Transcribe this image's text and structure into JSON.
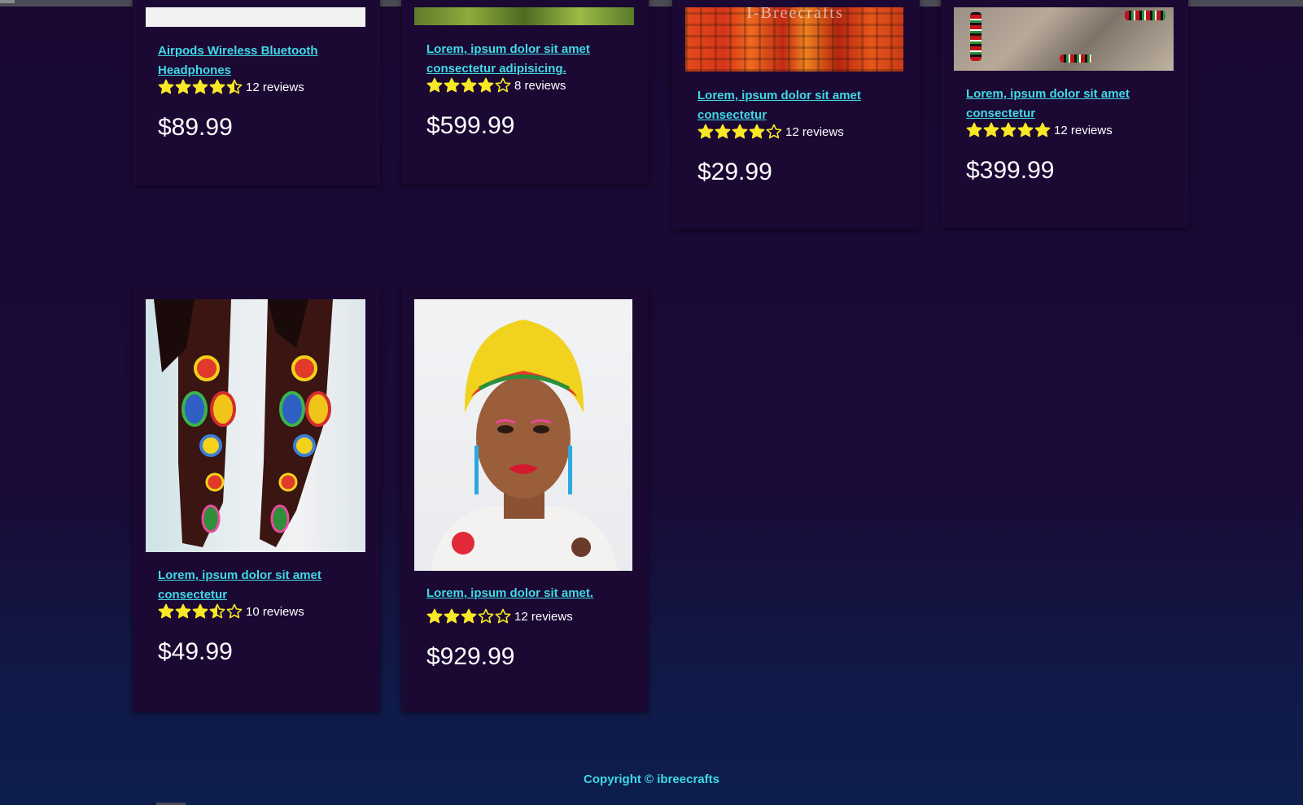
{
  "products": [
    {
      "title": "Airpods Wireless Bluetooth Headphones",
      "rating": 4.5,
      "reviews": "12 reviews",
      "price": "$89.99"
    },
    {
      "title": "Lorem, ipsum dolor sit amet consectetur adipisicing.",
      "rating": 4,
      "reviews": "8 reviews",
      "price": "$599.99"
    },
    {
      "title": "Lorem, ipsum dolor sit amet consectetur",
      "rating": 4,
      "reviews": "12 reviews",
      "price": "$29.99"
    },
    {
      "title": "Lorem, ipsum dolor sit amet consectetur",
      "rating": 5,
      "reviews": "12 reviews",
      "price": "$399.99"
    },
    {
      "title": "Lorem, ipsum dolor sit amet consectetur",
      "rating": 3.5,
      "reviews": "10 reviews",
      "price": "$49.99"
    },
    {
      "title": "Lorem, ipsum dolor sit amet.",
      "rating": 3,
      "reviews": "12 reviews",
      "price": "$929.99"
    }
  ],
  "image_watermark": "I-Breecrafts",
  "footer": {
    "copyright": "Copyright © ibreecrafts"
  },
  "colors": {
    "background": "#1a0833",
    "card": "#1b0833",
    "link": "#41d9e6",
    "star": "#f8e825"
  }
}
